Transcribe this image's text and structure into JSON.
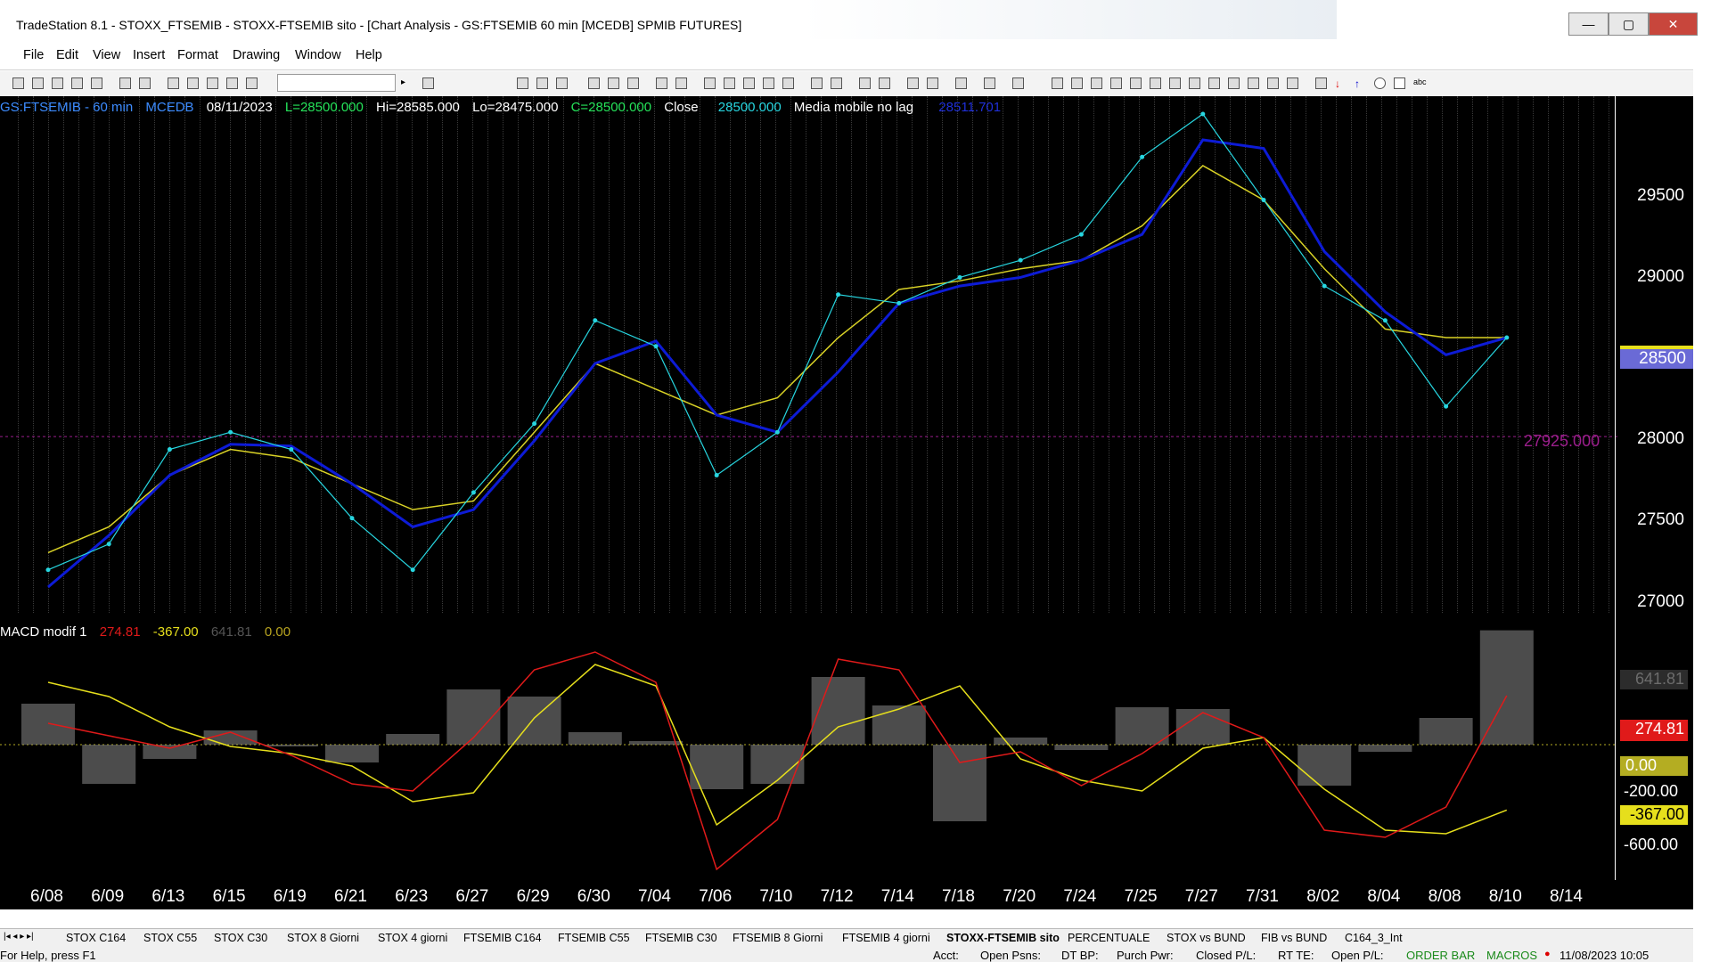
{
  "window": {
    "title": "TradeStation 8.1 - STOXX_FTSEMIB - STOXX-FTSEMIB sito - [Chart Analysis - GS:FTSEMIB  60 min  [MCEDB] SPMIB FUTURES]",
    "minimize_glyph": "—",
    "maximize_glyph": "▢",
    "close_glyph": "✕"
  },
  "menu": [
    "File",
    "Edit",
    "View",
    "Insert",
    "Format",
    "Drawing",
    "Window",
    "Help"
  ],
  "status": {
    "symbol": "GS:FTSEMIB - 60 min",
    "feed": "MCEDB",
    "date": "08/11/2023",
    "last": "L=28500.000",
    "high": "Hi=28585.000",
    "low": "Lo=28475.000",
    "close_value": "C=28500.000",
    "close_label": "Close",
    "close_price": "28500.000",
    "indicator_name": "Media mobile no lag",
    "indicator_value": "28511.701"
  },
  "macd": {
    "name": "MACD modif 1",
    "v1": "274.81",
    "v2": "-367.00",
    "v3": "641.81",
    "v4": "0.00"
  },
  "price_axis": {
    "ticks": [
      "29500",
      "29000",
      "28500",
      "28000",
      "27500",
      "27000"
    ],
    "current_price_label": "28500",
    "hline_label": "27925.000"
  },
  "macd_axis": {
    "labels": [
      "641.81",
      "274.81",
      "0.00",
      "-200.00",
      "-367.00",
      "-600.00"
    ]
  },
  "dates": [
    "6/08",
    "6/09",
    "6/13",
    "6/15",
    "6/19",
    "6/21",
    "6/23",
    "6/27",
    "6/29",
    "6/30",
    "7/04",
    "7/06",
    "7/10",
    "7/12",
    "7/14",
    "7/18",
    "7/20",
    "7/24",
    "7/25",
    "7/27",
    "7/31",
    "8/02",
    "8/04",
    "8/08",
    "8/10",
    "8/14"
  ],
  "tabs": [
    "STOX C164",
    "STOX C55",
    "STOX  C30",
    "STOX  8 Giorni",
    "STOX 4 giorni",
    "FTSEMIB C164",
    "FTSEMIB C55",
    "FTSEMIB C30",
    "FTSEMIB  8 Giorni",
    "FTSEMIB  4 giorni",
    "STOXX-FTSEMIB sito",
    "PERCENTUALE",
    "STOX vs BUND",
    "FIB vs BUND",
    "C164_3_Int"
  ],
  "active_tab": "STOXX-FTSEMIB sito",
  "statusbar": {
    "help": "For Help, press F1",
    "acct": "Acct:",
    "open_psns": "Open Psns:",
    "dt_bp": "DT BP:",
    "purch_pwr": "Purch Pwr:",
    "closed_pl": "Closed P/L:",
    "rt_te": "RT TE:",
    "open_pl": "Open P/L:",
    "order_bar": "ORDER BAR",
    "macros": "MACROS",
    "clock": "11/08/2023 10:05"
  },
  "colors": {
    "price_line": "#27d6e0",
    "ma_blue": "#0d1bd6",
    "ma_yellow": "#d9d226",
    "macd_red": "#e01a1a",
    "macd_yellow": "#e6df1c",
    "histogram": "#8a8a8a",
    "hline": "#9b1e8c"
  },
  "chart_data": {
    "type": "line",
    "price_series": {
      "name": "GS:FTSEMIB - 60 min",
      "x": [
        "6/08",
        "6/09",
        "6/13",
        "6/15",
        "6/19",
        "6/21",
        "6/23",
        "6/27",
        "6/29",
        "6/30",
        "7/04",
        "7/06",
        "7/10",
        "7/12",
        "7/14",
        "7/18",
        "7/20",
        "7/24",
        "7/25",
        "7/27",
        "7/31",
        "8/02",
        "8/04",
        "8/08",
        "8/10"
      ],
      "values": [
        27150,
        27300,
        27850,
        27950,
        27850,
        27450,
        27150,
        27600,
        28000,
        28600,
        28450,
        27700,
        27950,
        28750,
        28700,
        28850,
        28950,
        29100,
        29550,
        29800,
        29300,
        28800,
        28600,
        28100,
        28500
      ]
    },
    "blue_ma": {
      "name": "Media mobile no lag",
      "values": [
        27050,
        27350,
        27700,
        27880,
        27870,
        27650,
        27400,
        27500,
        27900,
        28350,
        28480,
        28050,
        27950,
        28300,
        28700,
        28800,
        28850,
        28950,
        29100,
        29650,
        29600,
        29000,
        28650,
        28400,
        28500
      ]
    },
    "yellow_ma": {
      "values": [
        27250,
        27400,
        27700,
        27850,
        27800,
        27650,
        27500,
        27550,
        27950,
        28350,
        28200,
        28050,
        28150,
        28500,
        28780,
        28830,
        28900,
        28950,
        29150,
        29500,
        29300,
        28900,
        28550,
        28500,
        28500
      ]
    },
    "hline": 27925,
    "ylim": [
      26900,
      29800
    ],
    "macd": {
      "ylim": [
        -700,
        700
      ],
      "red": [
        120,
        50,
        -20,
        70,
        -60,
        -220,
        -260,
        40,
        420,
        520,
        350,
        -700,
        -420,
        480,
        420,
        -100,
        -40,
        -230,
        -50,
        180,
        40,
        -480,
        -520,
        -350,
        274.81
      ],
      "yellow": [
        350,
        270,
        100,
        -10,
        -50,
        -120,
        -320,
        -270,
        150,
        450,
        330,
        -450,
        -200,
        100,
        200,
        330,
        -80,
        -200,
        -260,
        -20,
        40,
        -250,
        -480,
        -500,
        -367
      ],
      "histogram": [
        230,
        -220,
        -80,
        80,
        -10,
        -100,
        60,
        310,
        270,
        70,
        20,
        -250,
        -220,
        380,
        220,
        -430,
        40,
        -30,
        210,
        200,
        0,
        -230,
        -40,
        150,
        641.81
      ]
    }
  }
}
